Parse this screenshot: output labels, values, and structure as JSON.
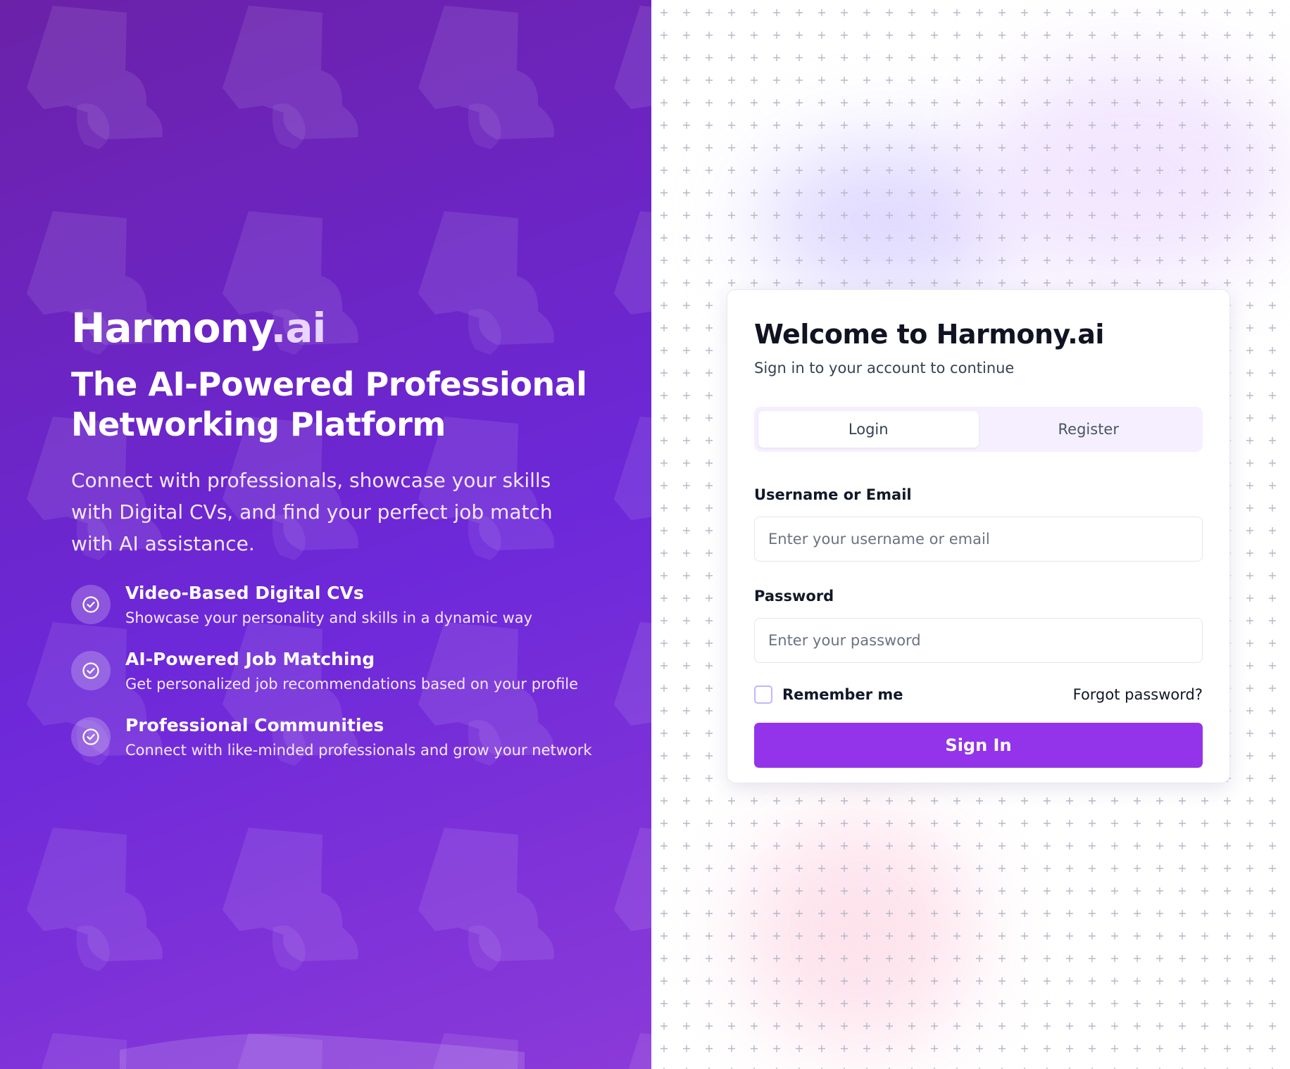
{
  "hero": {
    "brand_main": "Harmony",
    "brand_suffix": ".ai",
    "tagline_line1": "The AI-Powered Professional",
    "tagline_line2": "Networking Platform",
    "description": "Connect with professionals, showcase your skills with Digital CVs, and find your perfect job match with AI assistance.",
    "features": [
      {
        "title": "Video-Based Digital CVs",
        "description": "Showcase your personality and skills in a dynamic way",
        "icon": "check-circle-icon"
      },
      {
        "title": "AI-Powered Job Matching",
        "description": "Get personalized job recommendations based on your profile",
        "icon": "check-circle-icon"
      },
      {
        "title": "Professional Communities",
        "description": "Connect with like-minded professionals and grow your network",
        "icon": "check-circle-icon"
      }
    ]
  },
  "card": {
    "title": "Welcome to Harmony.ai",
    "subtitle": "Sign in to your account to continue",
    "tabs": [
      {
        "label": "Login",
        "active": true
      },
      {
        "label": "Register",
        "active": false
      }
    ],
    "username": {
      "label": "Username or Email",
      "placeholder": "Enter your username or email",
      "value": ""
    },
    "password": {
      "label": "Password",
      "placeholder": "Enter your password",
      "value": ""
    },
    "remember_label": "Remember me",
    "remember_checked": false,
    "forgot_label": "Forgot password?",
    "submit_label": "Sign In"
  },
  "colors": {
    "accent": "#9333ea",
    "hero_start": "#6b21a8",
    "hero_end": "#8b3ad8",
    "tab_track": "#f5efff"
  }
}
